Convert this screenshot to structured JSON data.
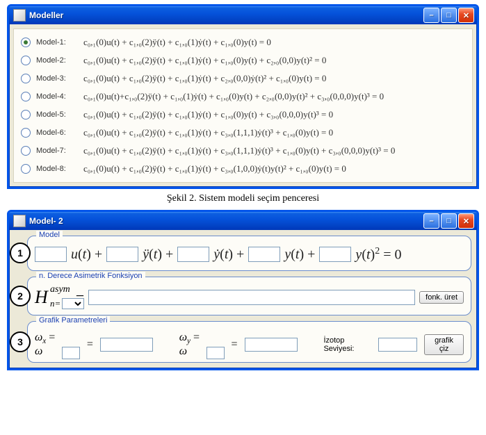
{
  "window1": {
    "title": "Modeller",
    "models": [
      {
        "label": "Model-1:",
        "selected": true,
        "eqn": "c₀,₁(0)u(t) + c₁,₀(2)ÿ(t) + c₁,₀(1)ẏ(t) + c₁,₀(0)y(t) = 0"
      },
      {
        "label": "Model-2:",
        "selected": false,
        "eqn": "c₀,₁(0)u(t) + c₁,₀(2)ÿ(t) + c₁,₀(1)ẏ(t) + c₁,₀(0)y(t) + c₂,₀(0,0)y(t)² = 0"
      },
      {
        "label": "Model-3:",
        "selected": false,
        "eqn": "c₀,₁(0)u(t) + c₁,₀(2)ÿ(t) + c₁,₀(1)ẏ(t) + c₂,₀(0,0)ẏ(t)² + c₁,₀(0)y(t) = 0"
      },
      {
        "label": "Model-4:",
        "selected": false,
        "eqn": "c₀,₁(0)u(t)+c₁,₀(2)ÿ(t) + c₁,₀(1)ẏ(t) + c₁,₀(0)y(t) + c₂,₀(0,0)y(t)² + c₃,₀(0,0,0)y(t)³ = 0"
      },
      {
        "label": "Model-5:",
        "selected": false,
        "eqn": "c₀,₁(0)u(t) + c₁,₀(2)ÿ(t) + c₁,₀(1)ẏ(t) + c₁,₀(0)y(t) + c₃,₀(0,0,0)y(t)³ = 0"
      },
      {
        "label": "Model-6:",
        "selected": false,
        "eqn": "c₀,₁(0)u(t) + c₁,₀(2)ÿ(t) + c₁,₀(1)ẏ(t) + c₃,₀(1,1,1)ẏ(t)³ + c₁,₀(0)y(t) = 0"
      },
      {
        "label": "Model-7:",
        "selected": false,
        "eqn": "c₀,₁(0)u(t) + c₁,₀(2)ÿ(t) + c₁,₀(1)ẏ(t) + c₃,₀(1,1,1)ẏ(t)³ + c₁,₀(0)y(t) + c₃,₀(0,0,0)y(t)³ = 0"
      },
      {
        "label": "Model-8:",
        "selected": false,
        "eqn": "c₀,₁(0)u(t) + c₁,₀(2)ÿ(t) + c₁,₀(1)ẏ(t) + c₃,₀(1,0,0)ẏ(t)y(t)² + c₁,₀(0)y(t) = 0"
      }
    ]
  },
  "caption": "Şekil 2. Sistem modeli seçim penceresi",
  "window2": {
    "title": "Model- 2",
    "group1": {
      "legend": "Model",
      "badge": "1",
      "terms": [
        "u(t) +",
        "ÿ(t) +",
        "ẏ(t) +",
        "y(t) +",
        "y(t)² = 0"
      ]
    },
    "group2": {
      "legend": "n. Derece Asimetrik Fonksiyon",
      "badge": "2",
      "sup": "asym",
      "subPrefix": "n=",
      "button": "fonk. üret"
    },
    "group3": {
      "legend": "Grafik Parametreleri",
      "badge": "3",
      "wx": "ωₓ = ω",
      "wy": "ω_y = ω",
      "izotop": "İzotop Seviyesi:",
      "button": "grafik çiz"
    }
  }
}
